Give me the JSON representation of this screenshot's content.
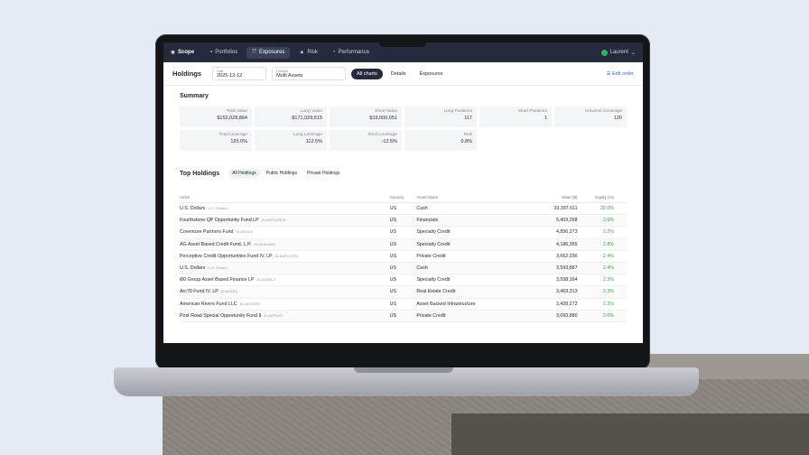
{
  "nav": {
    "brand": "Scope",
    "tabs": [
      {
        "label": "Portfolios",
        "icon": "briefcase-icon"
      },
      {
        "label": "Exposures",
        "icon": "arrows-icon"
      },
      {
        "label": "Risk",
        "icon": "triangle-icon"
      },
      {
        "label": "Performance",
        "icon": "chart-icon"
      }
    ],
    "active_tab": "Exposures",
    "user": "Laurent"
  },
  "header": {
    "title": "Holdings",
    "date_label": "Date",
    "date_value": "2025-12-12",
    "portfolio_label": "Portfolio",
    "portfolio_value": "Multi Assets",
    "views": [
      "All charts",
      "Details",
      "Exposures"
    ],
    "active_view": "All charts",
    "edit_label": "Edit order"
  },
  "summary": {
    "title": "Summary",
    "cards": [
      {
        "label": "Total Value",
        "value": "$152,028,864"
      },
      {
        "label": "Long Value",
        "value": "$171,029,515"
      },
      {
        "label": "Short Value",
        "value": "$19,000,651"
      },
      {
        "label": "Long Positions",
        "value": "117"
      },
      {
        "label": "Short Positions",
        "value": "1"
      },
      {
        "label": "Universe Coverage",
        "value": "120"
      },
      {
        "label": "Total Leverage",
        "value": "125.0%"
      },
      {
        "label": "Long Leverage",
        "value": "112.5%"
      },
      {
        "label": "Short Leverage",
        "value": "-12.5%"
      },
      {
        "label": "Risk",
        "value": "0.8%"
      }
    ]
  },
  "top_holdings": {
    "title": "Top Holdings",
    "tabs": [
      "All Holdings",
      "Public Holdings",
      "Private Holdings"
    ],
    "active_tab": "All Holdings",
    "columns": [
      "Asset",
      "Country",
      "Asset Class",
      "Value ($)",
      "Equity (%)"
    ],
    "rows": [
      {
        "asset": "U.S. Dollars",
        "code": "U.S. Dollars",
        "country": "US",
        "asset_class": "Cash",
        "value": "33,397,611",
        "equity": "22.0%"
      },
      {
        "asset": "Fourthstone QP Opportunity Fund LP",
        "code": "ELAKFOURTH",
        "country": "US",
        "asset_class": "Financials",
        "value": "5,403,268",
        "equity": "3.6%"
      },
      {
        "asset": "Coventure Partners Fund",
        "code": "ELAKCOV",
        "country": "US",
        "asset_class": "Specialty Credit",
        "value": "4,856,273",
        "equity": "3.2%"
      },
      {
        "asset": "AG Asset Based Credit Fund, L.P.",
        "code": "ELAKAGABC",
        "country": "US",
        "asset_class": "Specialty Credit",
        "value": "4,186,355",
        "equity": "2.8%"
      },
      {
        "asset": "Perceptive Credit Opportunities Fund IV, LP",
        "code": "ELAKPCORIV",
        "country": "US",
        "asset_class": "Private Credit",
        "value": "3,662,036",
        "equity": "2.4%"
      },
      {
        "asset": "U.S. Dollars",
        "code": "U.S. Dollars",
        "country": "US",
        "asset_class": "Cash",
        "value": "3,593,887",
        "equity": "2.4%"
      },
      {
        "asset": "i80 Group Asset Based Finance LP",
        "code": "ELAKI80L2",
        "country": "US",
        "asset_class": "Specialty Credit",
        "value": "3,558,164",
        "equity": "2.3%"
      },
      {
        "asset": "Arc70 Fund IV, LP",
        "code": "ELAKARC",
        "country": "US",
        "asset_class": "Real Estate Credit",
        "value": "3,463,313",
        "equity": "2.3%"
      },
      {
        "asset": "American Rivers Fund LLC",
        "code": "ELAKRIVER",
        "country": "US",
        "asset_class": "Asset Backed Infrastructure",
        "value": "3,428,272",
        "equity": "2.3%"
      },
      {
        "asset": "Post Road Special Opportunity Fund II",
        "code": "ELAKPOST",
        "country": "US",
        "asset_class": "Private Credit",
        "value": "3,093,880",
        "equity": "2.0%"
      }
    ]
  },
  "colors": {
    "accent": "#262c3e",
    "positive": "#3aa64a",
    "link": "#3a5fcf"
  }
}
